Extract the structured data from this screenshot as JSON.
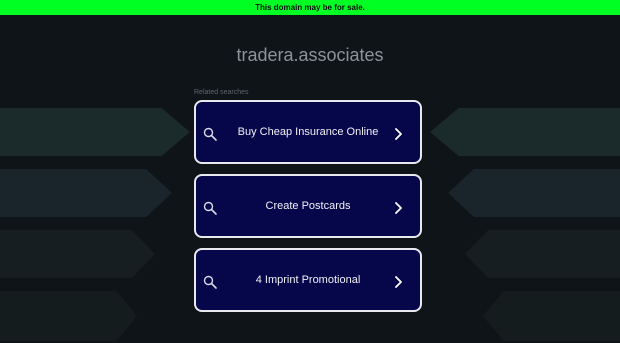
{
  "banner": {
    "text": "This domain may be for sale."
  },
  "site": {
    "domain": "tradera.associates"
  },
  "related": {
    "heading": "Related searches",
    "items": [
      {
        "label": "Buy Cheap Insurance Online"
      },
      {
        "label": "Create Postcards"
      },
      {
        "label": "4 Imprint Promotional"
      }
    ]
  },
  "colors": {
    "banner": "#00ff22",
    "background": "#0f1419",
    "item_fill": "#06064a",
    "item_border": "#e8e8ef"
  },
  "icons": {
    "item_left": "search-icon",
    "item_right": "chevron-right-icon"
  }
}
